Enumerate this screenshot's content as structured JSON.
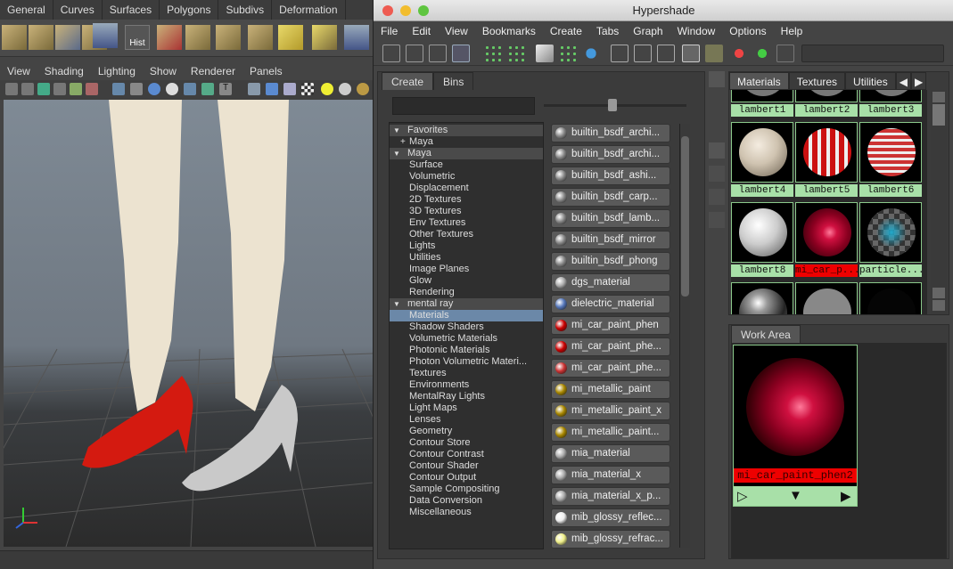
{
  "maya": {
    "shelf_tabs": [
      "General",
      "Curves",
      "Surfaces",
      "Polygons",
      "Subdivs",
      "Deformation"
    ],
    "shelf_hist_label": "Hist",
    "viewport_menu": [
      "View",
      "Shading",
      "Lighting",
      "Show",
      "Renderer",
      "Panels"
    ]
  },
  "hypershade": {
    "title": "Hypershade",
    "menu": [
      "File",
      "Edit",
      "View",
      "Bookmarks",
      "Create",
      "Tabs",
      "Graph",
      "Window",
      "Options",
      "Help"
    ],
    "create_tabs": [
      "Create",
      "Bins"
    ],
    "tree": [
      {
        "label": "Favorites",
        "type": "header"
      },
      {
        "label": "Maya",
        "type": "sub-collapsed"
      },
      {
        "label": "Maya",
        "type": "header"
      },
      {
        "label": "Surface"
      },
      {
        "label": "Volumetric"
      },
      {
        "label": "Displacement"
      },
      {
        "label": "2D Textures"
      },
      {
        "label": "3D Textures"
      },
      {
        "label": "Env Textures"
      },
      {
        "label": "Other Textures"
      },
      {
        "label": "Lights"
      },
      {
        "label": "Utilities"
      },
      {
        "label": "Image Planes"
      },
      {
        "label": "Glow"
      },
      {
        "label": "Rendering"
      },
      {
        "label": "mental ray",
        "type": "header"
      },
      {
        "label": "Materials",
        "type": "selected"
      },
      {
        "label": "Shadow Shaders"
      },
      {
        "label": "Volumetric Materials"
      },
      {
        "label": "Photonic Materials"
      },
      {
        "label": "Photon Volumetric Materi..."
      },
      {
        "label": "Textures"
      },
      {
        "label": "Environments"
      },
      {
        "label": "MentalRay Lights"
      },
      {
        "label": "Light Maps"
      },
      {
        "label": "Lenses"
      },
      {
        "label": "Geometry"
      },
      {
        "label": "Contour Store"
      },
      {
        "label": "Contour Contrast"
      },
      {
        "label": "Contour Shader"
      },
      {
        "label": "Contour Output"
      },
      {
        "label": "Sample Compositing"
      },
      {
        "label": "Data Conversion"
      },
      {
        "label": "Miscellaneous"
      }
    ],
    "nodes": [
      {
        "label": "builtin_bsdf_archi...",
        "icon": "#888"
      },
      {
        "label": "builtin_bsdf_archi...",
        "icon": "#888"
      },
      {
        "label": "builtin_bsdf_ashi...",
        "icon": "#888"
      },
      {
        "label": "builtin_bsdf_carp...",
        "icon": "#888"
      },
      {
        "label": "builtin_bsdf_lamb...",
        "icon": "#888"
      },
      {
        "label": "builtin_bsdf_mirror",
        "icon": "#888"
      },
      {
        "label": "builtin_bsdf_phong",
        "icon": "#888"
      },
      {
        "label": "dgs_material",
        "icon": "#aaa"
      },
      {
        "label": "dielectric_material",
        "icon": "#57b"
      },
      {
        "label": "mi_car_paint_phen",
        "icon": "#c00"
      },
      {
        "label": "mi_car_paint_phe...",
        "icon": "#c00"
      },
      {
        "label": "mi_car_paint_phe...",
        "icon": "#c33"
      },
      {
        "label": "mi_metallic_paint",
        "icon": "#a80"
      },
      {
        "label": "mi_metallic_paint_x",
        "icon": "#a80"
      },
      {
        "label": "mi_metallic_paint...",
        "icon": "#a80"
      },
      {
        "label": "mia_material",
        "icon": "#aaa"
      },
      {
        "label": "mia_material_x",
        "icon": "#aaa"
      },
      {
        "label": "mia_material_x_p...",
        "icon": "#aaa"
      },
      {
        "label": "mib_glossy_reflec...",
        "icon": "#eee"
      },
      {
        "label": "mib_glossy_refrac...",
        "icon": "#ee8"
      }
    ],
    "material_tabs": [
      "Materials",
      "Textures",
      "Utilities"
    ],
    "materials": [
      {
        "name": "lambert1",
        "style": "plain"
      },
      {
        "name": "lambert2",
        "style": "plain"
      },
      {
        "name": "lambert3",
        "style": "plain"
      },
      {
        "name": "lambert4",
        "style": "tan"
      },
      {
        "name": "lambert5",
        "style": "redwhite"
      },
      {
        "name": "lambert6",
        "style": "stripes"
      },
      {
        "name": "lambert8",
        "style": "white"
      },
      {
        "name": "mi_car_p...",
        "style": "redglow",
        "highlight": true
      },
      {
        "name": "particle...",
        "style": "checker"
      },
      {
        "name": "",
        "style": "chrome"
      },
      {
        "name": "",
        "style": "gray"
      },
      {
        "name": "",
        "style": "black"
      }
    ],
    "work_area_tab": "Work Area",
    "work_area_node": "mi_car_paint_phen2"
  }
}
